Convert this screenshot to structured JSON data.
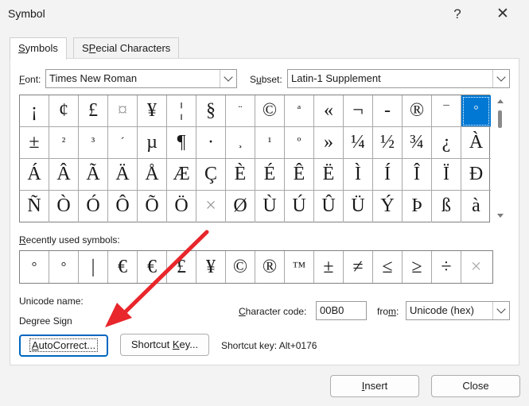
{
  "window": {
    "title": "Symbol",
    "help_label": "?",
    "close_label": "✕"
  },
  "tabs": [
    {
      "label": "Symbols",
      "accel": "S",
      "rest": "ymbols"
    },
    {
      "label": "Special Characters",
      "accel": "P",
      "pre": "S",
      "rest": "ecial Characters"
    }
  ],
  "font": {
    "label_accel": "F",
    "label_rest": "ont:",
    "value": "Times New Roman"
  },
  "subset": {
    "label_pre": "S",
    "label_accel": "u",
    "label_rest": "bset:",
    "value": "Latin-1 Supplement"
  },
  "symbols": [
    [
      "¡",
      "¢",
      "£",
      "¤",
      "¥",
      "¦",
      "§",
      "¨",
      "©",
      "ª",
      "«",
      "¬",
      "-",
      "®",
      "¯",
      "°"
    ],
    [
      "±",
      "²",
      "³",
      "´",
      "µ",
      "¶",
      "·",
      "¸",
      "¹",
      "º",
      "»",
      "¼",
      "½",
      "¾",
      "¿",
      "À"
    ],
    [
      "Á",
      "Â",
      "Ã",
      "Ä",
      "Å",
      "Æ",
      "Ç",
      "È",
      "É",
      "Ê",
      "Ë",
      "Ì",
      "Í",
      "Î",
      "Ï",
      "Ð"
    ],
    [
      "Ñ",
      "Ò",
      "Ó",
      "Ô",
      "Õ",
      "Ö",
      "×",
      "Ø",
      "Ù",
      "Ú",
      "Û",
      "Ü",
      "Ý",
      "Þ",
      "ß",
      "à"
    ]
  ],
  "recent": {
    "label_accel": "R",
    "label_rest": "ecently used symbols:",
    "items": [
      "°",
      "°",
      "|",
      "€",
      "€",
      "£",
      "¥",
      "©",
      "®",
      "™",
      "±",
      "≠",
      "≤",
      "≥",
      "÷",
      "×"
    ]
  },
  "unicode_name_label": "Unicode name:",
  "unicode_name_value": "Degree Sign",
  "character_code": {
    "label_accel": "C",
    "label_rest": "haracter code:",
    "value": "00B0"
  },
  "from": {
    "label_pre": "fro",
    "label_accel": "m",
    "label_rest": ":",
    "value": "Unicode (hex)"
  },
  "buttons": {
    "autocorrect": {
      "accel": "A",
      "rest": "utoCorrect..."
    },
    "shortcut_key": {
      "pre": "Shortcut ",
      "accel": "K",
      "rest": "ey..."
    },
    "insert": {
      "accel": "I",
      "rest": "nsert"
    },
    "close": "Close"
  },
  "shortcut_key_text": "Shortcut key: Alt+0176",
  "colors": {
    "selection": "#0078d4",
    "annotation_arrow": "#e8262b"
  }
}
